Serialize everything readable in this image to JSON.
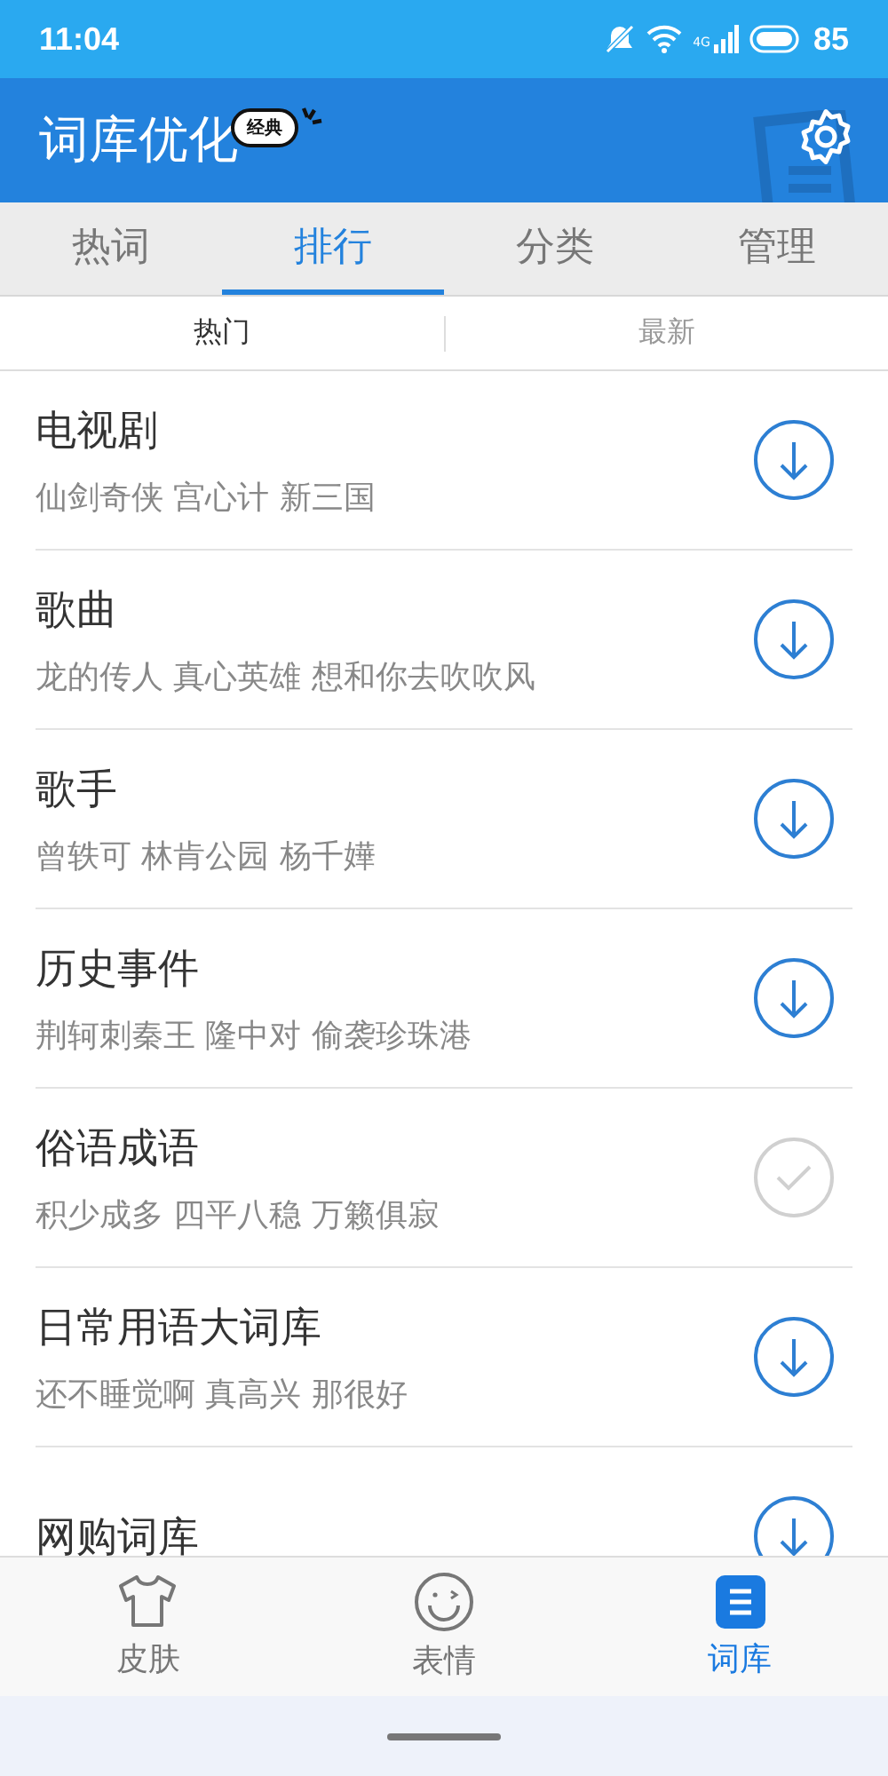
{
  "status_bar": {
    "time": "11:04",
    "network": "4G",
    "battery": "85"
  },
  "header": {
    "title": "词库优化",
    "badge": "经典"
  },
  "tabs": [
    {
      "label": "热词",
      "selected": false
    },
    {
      "label": "排行",
      "selected": true
    },
    {
      "label": "分类",
      "selected": false
    },
    {
      "label": "管理",
      "selected": false
    }
  ],
  "sub_tabs": [
    {
      "label": "热门",
      "selected": true
    },
    {
      "label": "最新",
      "selected": false
    }
  ],
  "items": [
    {
      "title": "电视剧",
      "examples": "仙剑奇侠 宫心计 新三国",
      "installed": false
    },
    {
      "title": "歌曲",
      "examples": "龙的传人 真心英雄 想和你去吹吹风",
      "installed": false
    },
    {
      "title": "歌手",
      "examples": "曾轶可 林肯公园 杨千嬅",
      "installed": false
    },
    {
      "title": "历史事件",
      "examples": "荆轲刺秦王 隆中对 偷袭珍珠港",
      "installed": false
    },
    {
      "title": "俗语成语",
      "examples": "积少成多 四平八稳 万籁俱寂",
      "installed": true
    },
    {
      "title": "日常用语大词库",
      "examples": "还不睡觉啊 真高兴 那很好",
      "installed": false
    },
    {
      "title": "网购词库",
      "installed": false
    }
  ],
  "bottom_nav": [
    {
      "label": "皮肤",
      "kind": "skin",
      "selected": false
    },
    {
      "label": "表情",
      "kind": "emoji",
      "selected": false
    },
    {
      "label": "词库",
      "kind": "dict",
      "selected": true
    }
  ]
}
